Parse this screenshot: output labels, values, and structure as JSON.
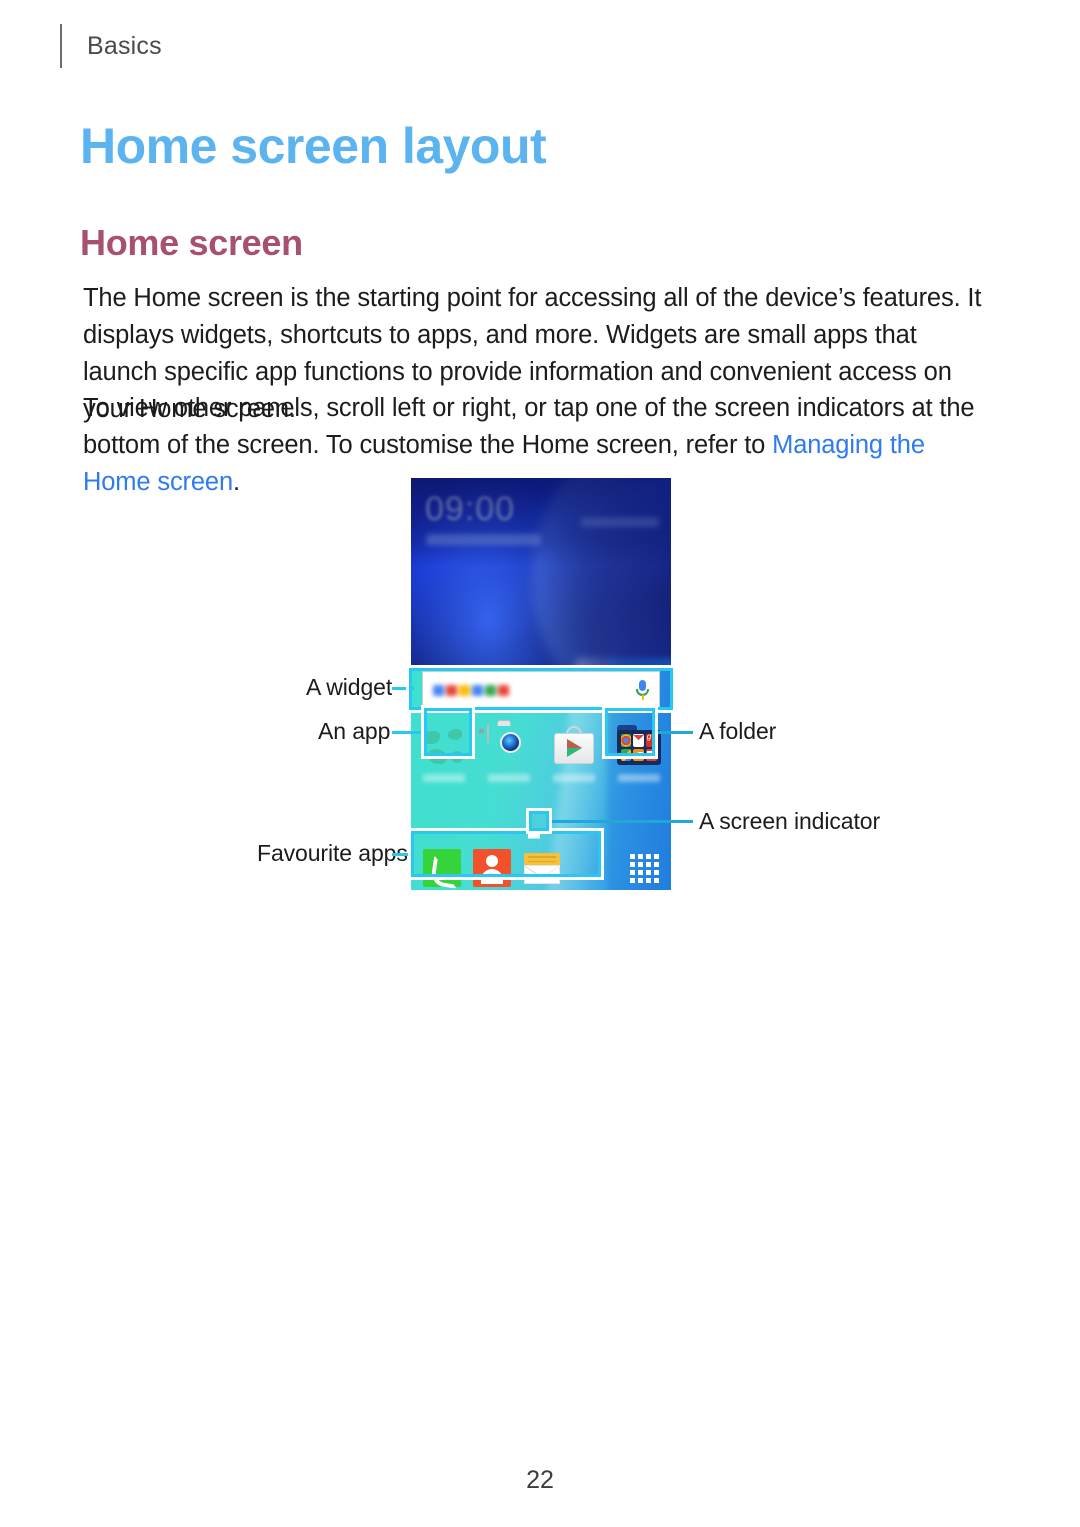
{
  "header": {
    "breadcrumb": "Basics"
  },
  "page_title": "Home screen layout",
  "section_title": "Home screen",
  "paragraphs": {
    "p1": "The Home screen is the starting point for accessing all of the device’s features. It displays widgets, shortcuts to apps, and more. Widgets are small apps that launch specific app functions to provide information and convenient access on your Home screen.",
    "p2_before": "To view other panels, scroll left or right, or tap one of the screen indicators at the bottom of the screen. To customise the Home screen, refer to ",
    "p2_link": "Managing the Home screen",
    "p2_after": "."
  },
  "figure": {
    "callouts": {
      "widget": "A widget",
      "app": "An app",
      "favourite_apps": "Favourite apps",
      "folder": "A folder",
      "screen_indicator": "A screen indicator"
    },
    "phone": {
      "clock_time": "09:00",
      "search_widget": {
        "logo": "google-logo",
        "mic": "microphone-icon"
      },
      "apps": [
        {
          "name": "internet",
          "icon": "globe-icon"
        },
        {
          "name": "camera",
          "icon": "camera-icon"
        },
        {
          "name": "play-store",
          "icon": "play-store-icon"
        },
        {
          "name": "folder",
          "icon": "folder-icon"
        }
      ],
      "folder_contents": [
        "chrome",
        "gmail",
        "google-plus",
        "maps",
        "play-music",
        "play-movies"
      ],
      "dock": [
        {
          "name": "phone",
          "icon": "phone-icon"
        },
        {
          "name": "contacts",
          "icon": "contacts-icon"
        },
        {
          "name": "messages",
          "icon": "messages-icon"
        },
        {
          "name": "apps",
          "icon": "apps-grid-icon"
        }
      ],
      "screen_indicator_icon": "home-icon"
    }
  },
  "footer": {
    "page_number": "22"
  },
  "colors": {
    "title": "#5bb3f0",
    "section": "#a75070",
    "link": "#2e7bf0",
    "highlight": "#28c8f0"
  }
}
